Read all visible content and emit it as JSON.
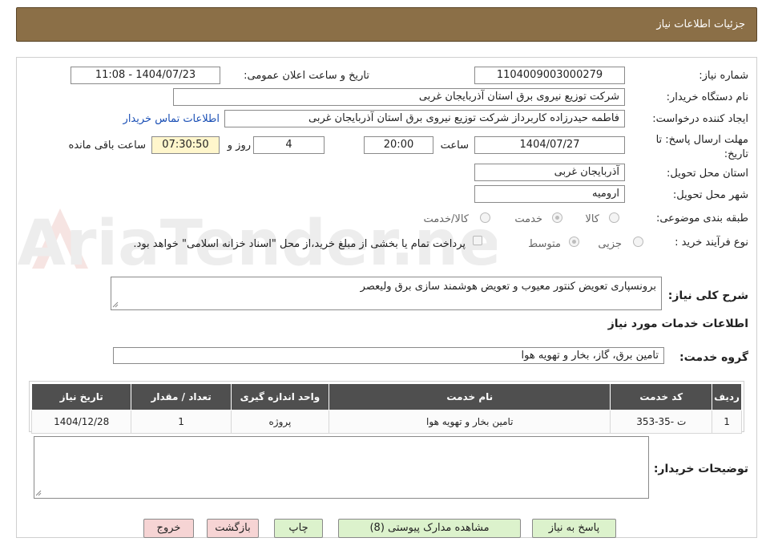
{
  "header": {
    "title": "جزئیات اطلاعات نیاز"
  },
  "watermark": {
    "text": "AriaTender.neT"
  },
  "form": {
    "need_number": {
      "label": "شماره نیاز:",
      "value": "1104009003000279"
    },
    "announce": {
      "label": "تاریخ و ساعت اعلان عمومی:",
      "value": "1404/07/23 - 11:08"
    },
    "buyer_org": {
      "label": "نام دستگاه خریدار:",
      "value": "شرکت توزیع نیروی برق استان آذربایجان غربی"
    },
    "requester": {
      "label": "ایجاد کننده درخواست:",
      "value": "فاطمه حیدرزاده کاربرداز شرکت توزیع نیروی برق استان آذربایجان غربی",
      "contact_link": "اطلاعات تماس خریدار"
    },
    "deadline": {
      "label": "مهلت ارسال پاسخ: تا تاریخ:",
      "date": "1404/07/27",
      "time_label": "ساعت",
      "time": "20:00",
      "days": "4",
      "days_label": "روز و",
      "remaining": "07:30:50",
      "remaining_label": "ساعت باقی مانده"
    },
    "province": {
      "label": "استان محل تحویل:",
      "value": "آذربایجان غربی"
    },
    "city": {
      "label": "شهر محل تحویل:",
      "value": "ارومیه"
    },
    "category": {
      "label": "طبقه بندی موضوعی:",
      "options": [
        "کالا",
        "خدمت",
        "کالا/خدمت"
      ],
      "selected": "خدمت"
    },
    "process": {
      "label": "نوع فرآیند خرید :",
      "options": [
        "جزیی",
        "متوسط"
      ],
      "selected": "متوسط",
      "payment_note": "پرداخت تمام یا بخشی از مبلغ خرید،از محل \"اسناد خزانه اسلامی\" خواهد بود."
    },
    "description": {
      "label": "شرح کلی نیاز:",
      "value": "برونسپاری تعویض کنتور معیوب و تعویض هوشمند سازی برق ولیعصر"
    },
    "services_title": "اطلاعات خدمات مورد نیاز",
    "service_group": {
      "label": "گروه خدمت:",
      "value": "تامین برق، گاز، بخار و تهویه هوا"
    },
    "table": {
      "headers": [
        "ردیف",
        "کد خدمت",
        "نام خدمت",
        "واحد اندازه گیری",
        "تعداد / مقدار",
        "تاریخ نیاز"
      ],
      "rows": [
        [
          "1",
          "ت -35-353",
          "تامین بخار و تهویه هوا",
          "پروژه",
          "1",
          "1404/12/28"
        ]
      ]
    },
    "buyer_notes": {
      "label": "توضیحات خریدار:",
      "value": ""
    }
  },
  "buttons": {
    "reply": "پاسخ به نیاز",
    "attachments": "مشاهده مدارک پیوستی (8)",
    "print": "چاپ",
    "back": "بازگشت",
    "exit": "خروج"
  },
  "colors": {
    "header_bg": "#8b6f47",
    "table_header": "#4f4f4f",
    "link": "#1a4fb5",
    "btn_green": "#dcf2cc",
    "btn_pink": "#f6d4d4"
  }
}
